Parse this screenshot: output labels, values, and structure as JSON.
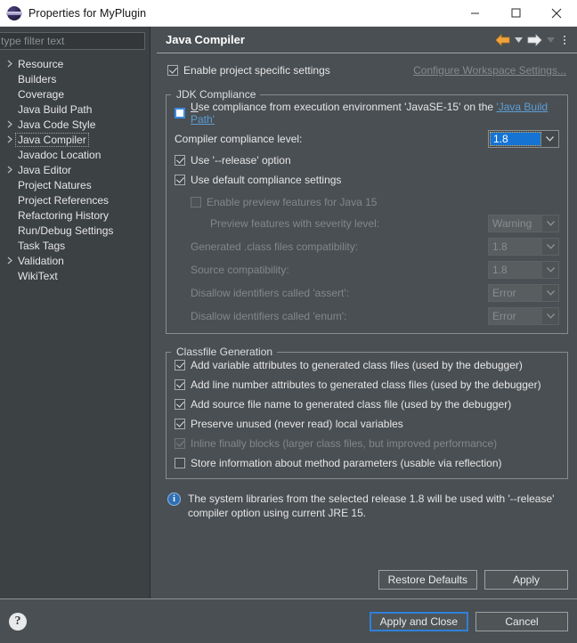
{
  "window": {
    "title": "Properties for MyPlugin",
    "icon": "eclipse-icon",
    "controls": {
      "minimize": "—",
      "maximize": "□",
      "close": "✕"
    }
  },
  "sidebar": {
    "filter_placeholder": "type filter text",
    "items": [
      {
        "label": "Resource",
        "expandable": true,
        "selected": false
      },
      {
        "label": "Builders",
        "expandable": false,
        "selected": false
      },
      {
        "label": "Coverage",
        "expandable": false,
        "selected": false
      },
      {
        "label": "Java Build Path",
        "expandable": false,
        "selected": false
      },
      {
        "label": "Java Code Style",
        "expandable": true,
        "selected": false
      },
      {
        "label": "Java Compiler",
        "expandable": true,
        "selected": true
      },
      {
        "label": "Javadoc Location",
        "expandable": false,
        "selected": false
      },
      {
        "label": "Java Editor",
        "expandable": true,
        "selected": false
      },
      {
        "label": "Project Natures",
        "expandable": false,
        "selected": false
      },
      {
        "label": "Project References",
        "expandable": false,
        "selected": false
      },
      {
        "label": "Refactoring History",
        "expandable": false,
        "selected": false
      },
      {
        "label": "Run/Debug Settings",
        "expandable": false,
        "selected": false
      },
      {
        "label": "Task Tags",
        "expandable": false,
        "selected": false
      },
      {
        "label": "Validation",
        "expandable": true,
        "selected": false
      },
      {
        "label": "WikiText",
        "expandable": false,
        "selected": false
      }
    ]
  },
  "page": {
    "title": "Java Compiler",
    "toolbar": {
      "back": "back-arrow-icon",
      "back_menu": "chevron-down-icon",
      "forward": "forward-arrow-icon",
      "forward_menu": "chevron-down-icon",
      "view_menu": "kebab-menu-icon"
    },
    "enable_project_specific": {
      "label": "Enable project specific settings",
      "underline_char": "o",
      "checked": true
    },
    "configure_workspace_link": "Configure Workspace Settings...",
    "jdk_compliance": {
      "title": "JDK Compliance",
      "use_compliance_from_ee": {
        "prefix": "U",
        "label": "se compliance from execution environment 'JavaSE-15' on the ",
        "link": "'Java Build Path'",
        "checked": false
      },
      "compliance_level": {
        "label": "Compiler compliance level:",
        "value": "1.8",
        "enabled": true,
        "focused": true
      },
      "use_release_option": {
        "label": "Use '--release' option",
        "checked": true,
        "enabled": true
      },
      "use_default_compliance": {
        "label": "Use default compliance settings",
        "checked": true,
        "enabled": true
      },
      "enable_preview": {
        "label": "Enable preview features for Java 15",
        "checked": false,
        "enabled": false
      },
      "rows": [
        {
          "label": "Preview features with severity level:",
          "value": "Warning",
          "enabled": false,
          "indent": 2
        },
        {
          "label": "Generated .class files compatibility:",
          "value": "1.8",
          "enabled": false,
          "indent": 1
        },
        {
          "label": "Source compatibility:",
          "value": "1.8",
          "enabled": false,
          "indent": 1
        },
        {
          "label": "Disallow identifiers called 'assert':",
          "value": "Error",
          "enabled": false,
          "indent": 1
        },
        {
          "label": "Disallow identifiers called 'enum':",
          "value": "Error",
          "enabled": false,
          "indent": 1
        }
      ]
    },
    "classfile_generation": {
      "title": "Classfile Generation",
      "items": [
        {
          "label": "Add variable attributes to generated class files (used by the debugger)",
          "checked": true,
          "enabled": true
        },
        {
          "label": "Add line number attributes to generated class files (used by the debugger)",
          "checked": true,
          "enabled": true
        },
        {
          "label": "Add source file name to generated class file (used by the debugger)",
          "checked": true,
          "enabled": true
        },
        {
          "label": "Preserve unused (never read) local variables",
          "checked": true,
          "enabled": true
        },
        {
          "label": "Inline finally blocks (larger class files, but improved performance)",
          "checked": true,
          "enabled": false
        },
        {
          "label": "Store information about method parameters (usable via reflection)",
          "checked": false,
          "enabled": true
        }
      ]
    },
    "info_message": "The system libraries from the selected release 1.8 will be used with '--release' compiler option using current JRE 15.",
    "restore_defaults_button": "Restore Defaults",
    "apply_button": "Apply"
  },
  "footer": {
    "help_icon": "help-icon",
    "apply_and_close_button": "Apply and Close",
    "cancel_button": "Cancel"
  },
  "colors": {
    "dialog_bg": "#4a4f53",
    "tree_bg": "#3c4144",
    "accent_link": "#5c9fd6",
    "selection_blue": "#1573d4",
    "focus_blue": "#2f80d8",
    "back_arrow": "#f0a33c",
    "info_blue": "#2f6fb5"
  }
}
